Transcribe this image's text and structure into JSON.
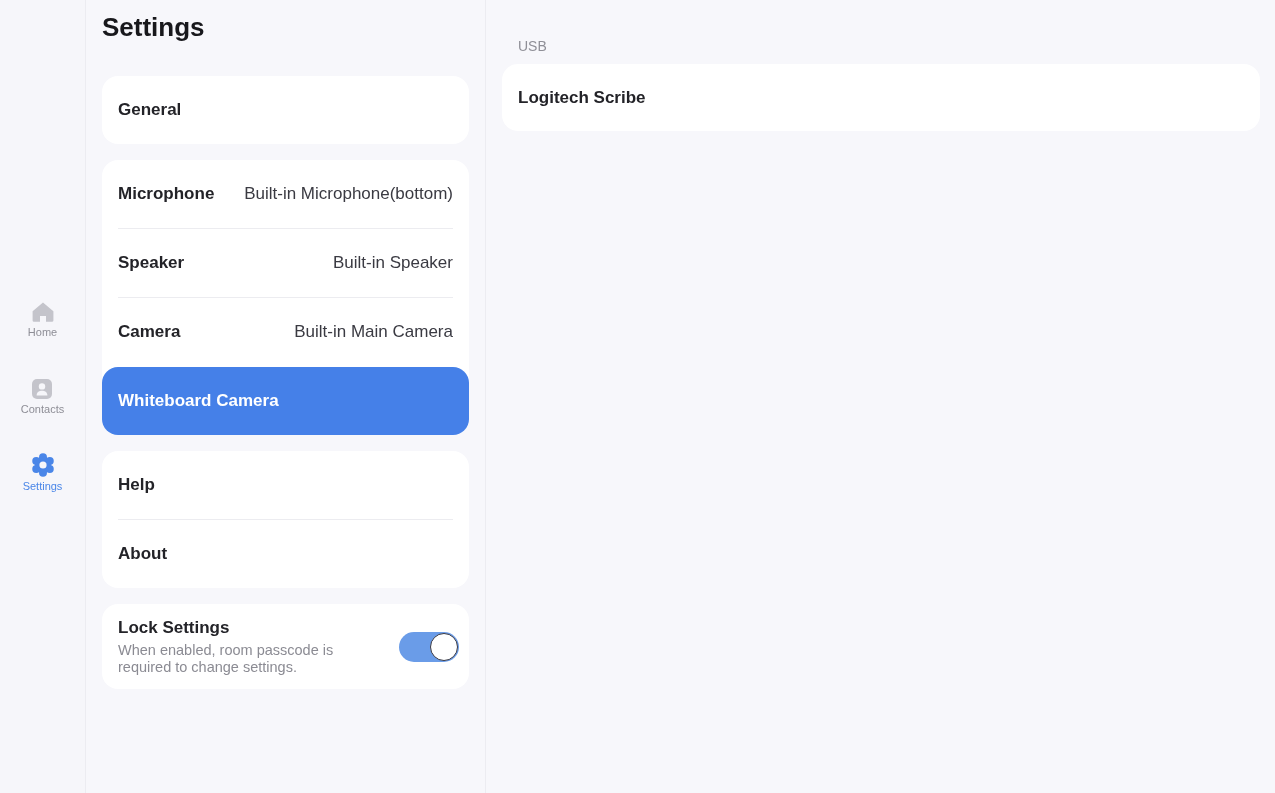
{
  "nav": {
    "items": [
      {
        "kind": "home",
        "label": "Home",
        "selected": false
      },
      {
        "kind": "contacts",
        "label": "Contacts",
        "selected": false
      },
      {
        "kind": "settings",
        "label": "Settings",
        "selected": true
      }
    ]
  },
  "settings_panel": {
    "title": "Settings",
    "groups": [
      {
        "items": [
          {
            "label": "General",
            "selected": false
          }
        ]
      },
      {
        "items": [
          {
            "label": "Microphone",
            "value": "Built-in Microphone(bottom)",
            "selected": false
          },
          {
            "label": "Speaker",
            "value": "Built-in Speaker",
            "selected": false
          },
          {
            "label": "Camera",
            "value": "Built-in Main Camera",
            "selected": false
          },
          {
            "label": "Whiteboard Camera",
            "selected": true
          }
        ]
      },
      {
        "items": [
          {
            "label": "Help",
            "selected": false
          },
          {
            "label": "About",
            "selected": false
          }
        ]
      }
    ],
    "lock_settings": {
      "title": "Lock Settings",
      "description": "When enabled, room passcode is required to change settings.",
      "on": true
    }
  },
  "detail_panel": {
    "section_label": "USB",
    "devices": [
      {
        "label": "Logitech Scribe"
      }
    ]
  }
}
